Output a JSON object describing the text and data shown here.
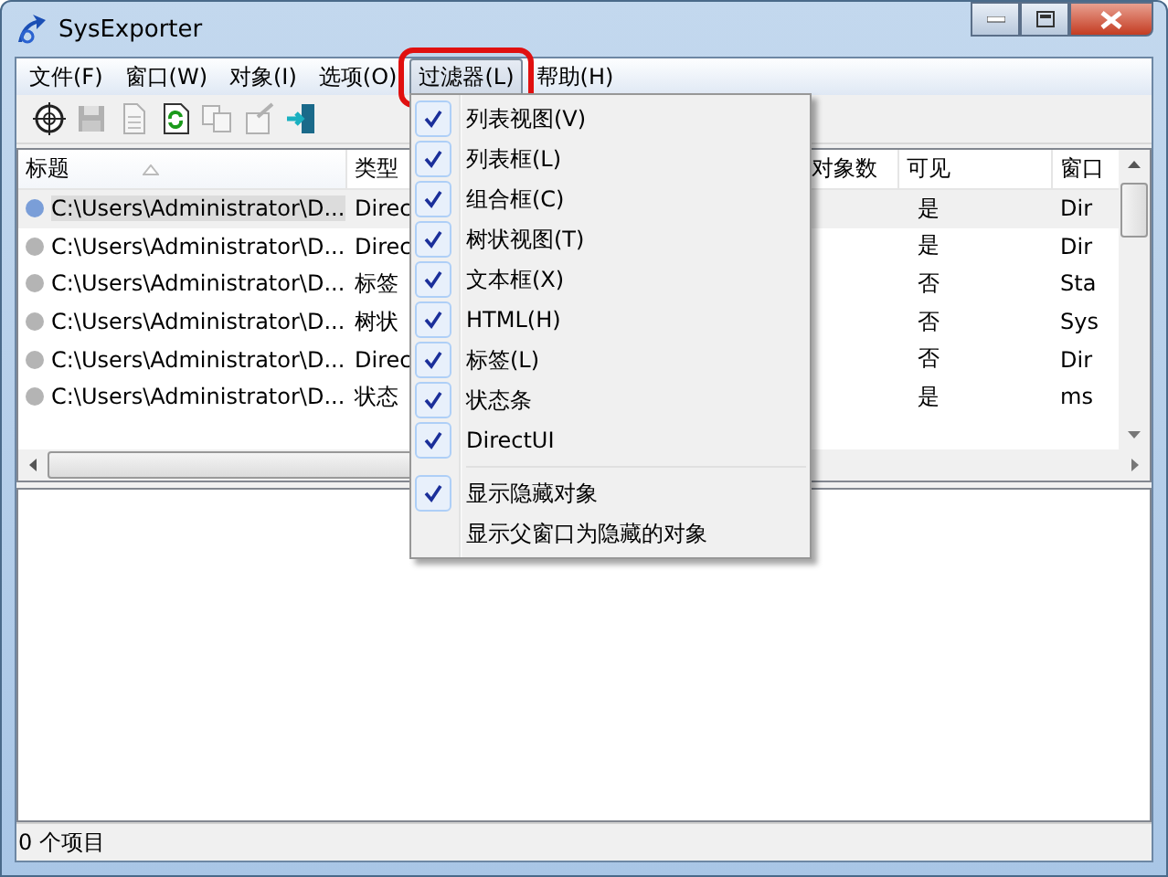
{
  "window": {
    "title": "SysExporter"
  },
  "menu_bar": [
    {
      "label": "文件(F)",
      "selected": false
    },
    {
      "label": "窗口(W)",
      "selected": false
    },
    {
      "label": "对象(I)",
      "selected": false
    },
    {
      "label": "选项(O)",
      "selected": false
    },
    {
      "label": "过滤器(L)",
      "selected": true
    },
    {
      "label": "帮助(H)",
      "selected": false
    }
  ],
  "toolbar": [
    {
      "kind": "target",
      "disabled": false
    },
    {
      "kind": "save",
      "disabled": true
    },
    {
      "kind": "document",
      "disabled": true
    },
    {
      "kind": "refresh",
      "disabled": false
    },
    {
      "kind": "copy",
      "disabled": true
    },
    {
      "kind": "properties",
      "disabled": true
    },
    {
      "kind": "exit",
      "disabled": false
    }
  ],
  "table": {
    "columns": [
      {
        "label": "标题",
        "sorted": true
      },
      {
        "label": "类型",
        "sorted": false
      },
      {
        "label": "对象数",
        "sorted": false
      },
      {
        "label": "可见",
        "sorted": false
      },
      {
        "label": "窗口",
        "sorted": false
      }
    ],
    "rows": [
      {
        "title": "C:\\Users\\Administrator\\D...",
        "type": "Direc",
        "visible": "是",
        "window": "Dir",
        "color": "#7a9ed8",
        "selected": true
      },
      {
        "title": "C:\\Users\\Administrator\\D...",
        "type": "Direc",
        "visible": "是",
        "window": "Dir",
        "color": "#b4b4b4",
        "selected": false
      },
      {
        "title": "C:\\Users\\Administrator\\D...",
        "type": "标签",
        "visible": "否",
        "window": "Sta",
        "color": "#b4b4b4",
        "selected": false
      },
      {
        "title": "C:\\Users\\Administrator\\D...",
        "type": "树状",
        "visible": "否",
        "window": "Sys",
        "color": "#b4b4b4",
        "selected": false
      },
      {
        "title": "C:\\Users\\Administrator\\D...",
        "type": "Direc",
        "visible": "否",
        "window": "Dir",
        "color": "#b4b4b4",
        "selected": false
      },
      {
        "title": "C:\\Users\\Administrator\\D...",
        "type": "状态",
        "visible": "是",
        "window": "ms",
        "color": "#b4b4b4",
        "selected": false
      }
    ]
  },
  "filter_menu": [
    {
      "kind": "item",
      "label": "列表视图(V)",
      "checked": true
    },
    {
      "kind": "item",
      "label": "列表框(L)",
      "checked": true
    },
    {
      "kind": "item",
      "label": "组合框(C)",
      "checked": true
    },
    {
      "kind": "item",
      "label": "树状视图(T)",
      "checked": true
    },
    {
      "kind": "item",
      "label": "文本框(X)",
      "checked": true
    },
    {
      "kind": "item",
      "label": "HTML(H)",
      "checked": true
    },
    {
      "kind": "item",
      "label": "标签(L)",
      "checked": true
    },
    {
      "kind": "item",
      "label": "状态条",
      "checked": true
    },
    {
      "kind": "item",
      "label": "DirectUI",
      "checked": true
    },
    {
      "kind": "separator"
    },
    {
      "kind": "item",
      "label": "显示隐藏对象",
      "checked": true
    },
    {
      "kind": "item",
      "label": "显示父窗口为隐藏的对象",
      "checked": false
    }
  ],
  "status_bar": {
    "text": "0 个项目"
  }
}
